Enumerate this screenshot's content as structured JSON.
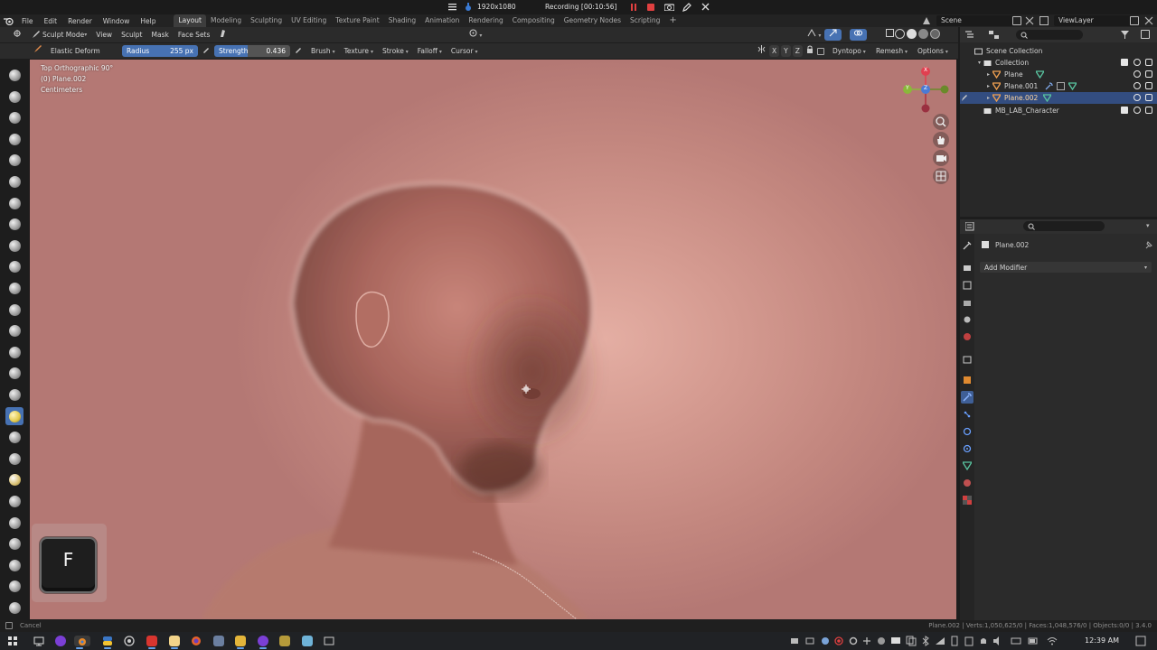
{
  "recording": {
    "resolution": "1920x1080",
    "status": "Recording [00:10:56]"
  },
  "menu": [
    "File",
    "Edit",
    "Render",
    "Window",
    "Help"
  ],
  "workspaces": [
    "Layout",
    "Modeling",
    "Sculpting",
    "UV Editing",
    "Texture Paint",
    "Shading",
    "Animation",
    "Rendering",
    "Compositing",
    "Geometry Nodes",
    "Scripting"
  ],
  "active_workspace": "Layout",
  "scene": {
    "label": "Scene",
    "view_layer": "ViewLayer"
  },
  "header": {
    "mode": "Sculpt Mode",
    "menus": [
      "View",
      "Sculpt",
      "Mask",
      "Face Sets"
    ],
    "brush_name": "Elastic Deform",
    "radius_label": "Radius",
    "radius_value": "255 px",
    "strength_label": "Strength",
    "strength_value": "0.436",
    "dropdowns": [
      "Brush",
      "Texture",
      "Stroke",
      "Falloff",
      "Cursor"
    ],
    "axes": [
      "X",
      "Y",
      "Z"
    ],
    "dyntopo": "Dyntopo",
    "remesh": "Remesh",
    "options": "Options"
  },
  "viewport": {
    "view_name": "Top Orthographic 90°",
    "object": "(0) Plane.002",
    "units": "Centimeters",
    "gizmo_labels": [
      "X",
      "Y",
      "Z"
    ]
  },
  "outliner": {
    "root": "Scene Collection",
    "items": [
      {
        "label": "Collection",
        "level": 1
      },
      {
        "label": "Plane",
        "level": 2
      },
      {
        "label": "Plane.001",
        "level": 2
      },
      {
        "label": "Plane.002",
        "level": 2,
        "selected": true
      },
      {
        "label": "MB_LAB_Character",
        "level": 1
      }
    ]
  },
  "properties": {
    "object_name": "Plane.002",
    "add_modifier": "Add Modifier"
  },
  "status": {
    "left": "Cancel",
    "right": "Plane.002 | Verts:1,050,625/0 | Faces:1,048,576/0 | Objects:0/0 | 3.4.0"
  },
  "keycast": "F",
  "clock": "12:39 AM",
  "colors": {
    "accent": "#4772b3",
    "viewport_bg": "#c98a82",
    "selected_row": "#334d80"
  }
}
